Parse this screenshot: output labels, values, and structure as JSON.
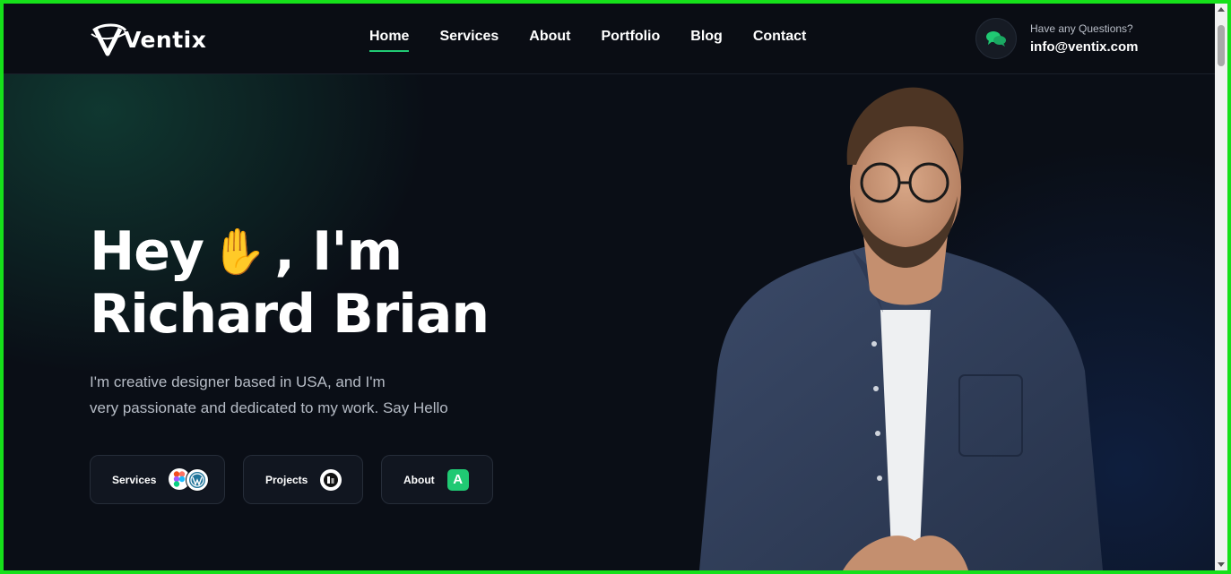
{
  "brand": {
    "logo_text": "Ventix"
  },
  "nav": {
    "items": [
      {
        "label": "Home",
        "active": true
      },
      {
        "label": "Services",
        "active": false
      },
      {
        "label": "About",
        "active": false
      },
      {
        "label": "Portfolio",
        "active": false
      },
      {
        "label": "Blog",
        "active": false
      },
      {
        "label": "Contact",
        "active": false
      }
    ]
  },
  "contact": {
    "label": "Have any Questions?",
    "email": "info@ventix.com",
    "icon": "chat-bubbles-icon"
  },
  "hero": {
    "greeting": "Hey",
    "wave_emoji": "✋",
    "greeting_suffix": ", I'm",
    "name": "Richard Brian",
    "description_line1": "I'm creative designer based in USA, and I'm",
    "description_line2": "very passionate and dedicated to my work. Say Hello"
  },
  "pills": [
    {
      "label": "Services",
      "icons": [
        "figma-icon",
        "wordpress-icon"
      ]
    },
    {
      "label": "Projects",
      "icons": [
        "project-logo-icon"
      ]
    },
    {
      "label": "About",
      "icons": [
        "letter-a-icon"
      ],
      "icon_text": "A"
    }
  ],
  "colors": {
    "accent": "#20c973",
    "background": "#0a0e16",
    "header": "#0a0d14",
    "frame": "#16e01a"
  }
}
